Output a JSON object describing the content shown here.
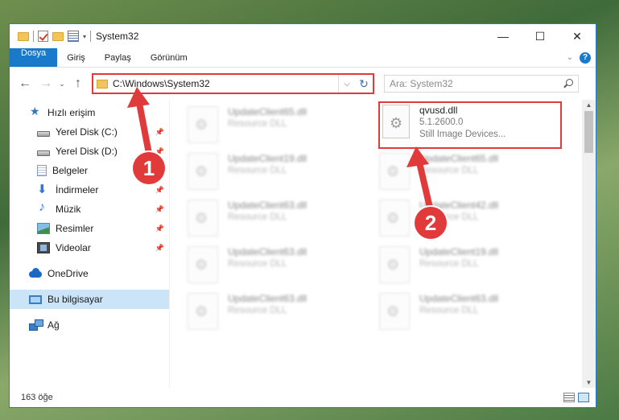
{
  "window": {
    "title": "System32",
    "controls": {
      "minimize": "—",
      "maximize": "☐",
      "close": "✕"
    }
  },
  "ribbon": {
    "tabs": [
      "Dosya",
      "Giriş",
      "Paylaş",
      "Görünüm"
    ],
    "help": "?"
  },
  "address_bar": {
    "path": "C:\\Windows\\System32",
    "refresh": "↻",
    "dropdown": "⌵"
  },
  "search": {
    "placeholder": "Ara: System32"
  },
  "navigation": {
    "back": "←",
    "forward": "→",
    "recent": "⌄",
    "up": "↑"
  },
  "sidebar": {
    "quick_access": "Hızlı erişim",
    "items": [
      {
        "label": "Yerel Disk (C:)",
        "icon": "drive-icon",
        "pinned": true
      },
      {
        "label": "Yerel Disk (D:)",
        "icon": "drive-icon",
        "pinned": true
      },
      {
        "label": "Belgeler",
        "icon": "documents-icon",
        "pinned": true
      },
      {
        "label": "İndirmeler",
        "icon": "downloads-icon",
        "pinned": true
      },
      {
        "label": "Müzik",
        "icon": "music-icon",
        "pinned": true
      },
      {
        "label": "Resimler",
        "icon": "pictures-icon",
        "pinned": true
      },
      {
        "label": "Videolar",
        "icon": "videos-icon",
        "pinned": true
      }
    ],
    "onedrive": "OneDrive",
    "this_pc": "Bu bilgisayar",
    "network": "Ağ"
  },
  "files": {
    "highlighted": {
      "name": "qvusd.dll",
      "version": "5.1.2600.0",
      "description": "Still Image Devices..."
    },
    "blurred": [
      {
        "name": "UpdateClient65.dll",
        "meta": "Resource DLL"
      },
      {
        "name": "UpdateClient19.dll",
        "meta": "Resource DLL"
      },
      {
        "name": "UpdateClient65.dll",
        "meta": "Resource DLL"
      },
      {
        "name": "UpdateClient63.dll",
        "meta": "Resource DLL"
      },
      {
        "name": "UpdateClient42.dll",
        "meta": "Resource DLL"
      },
      {
        "name": "UpdateClient63.dll",
        "meta": "Resource DLL"
      },
      {
        "name": "UpdateClient19.dll",
        "meta": "Resource DLL"
      },
      {
        "name": "UpdateClient63.dll",
        "meta": "Resource DLL"
      },
      {
        "name": "UpdateClient63.dll",
        "meta": "Resource DLL"
      }
    ]
  },
  "status": {
    "count": "163 öğe"
  },
  "callouts": {
    "one": "1",
    "two": "2"
  },
  "colors": {
    "accent": "#1979ca",
    "highlight": "#e03a3a",
    "selection": "#cce4f7"
  }
}
